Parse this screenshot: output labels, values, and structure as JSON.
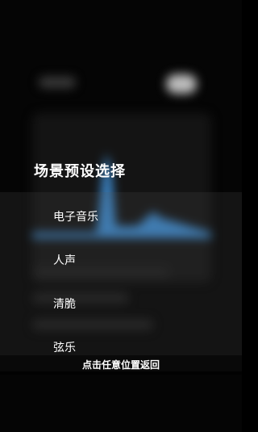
{
  "overlay": {
    "title": "场景预设选择",
    "options": [
      {
        "label": "电子音乐"
      },
      {
        "label": "人声"
      },
      {
        "label": "清脆"
      },
      {
        "label": "弦乐"
      }
    ],
    "return_hint": "点击任意位置返回"
  },
  "colors": {
    "accent": "#3f8fd6",
    "text": "#ffffff",
    "background": "#050505"
  }
}
